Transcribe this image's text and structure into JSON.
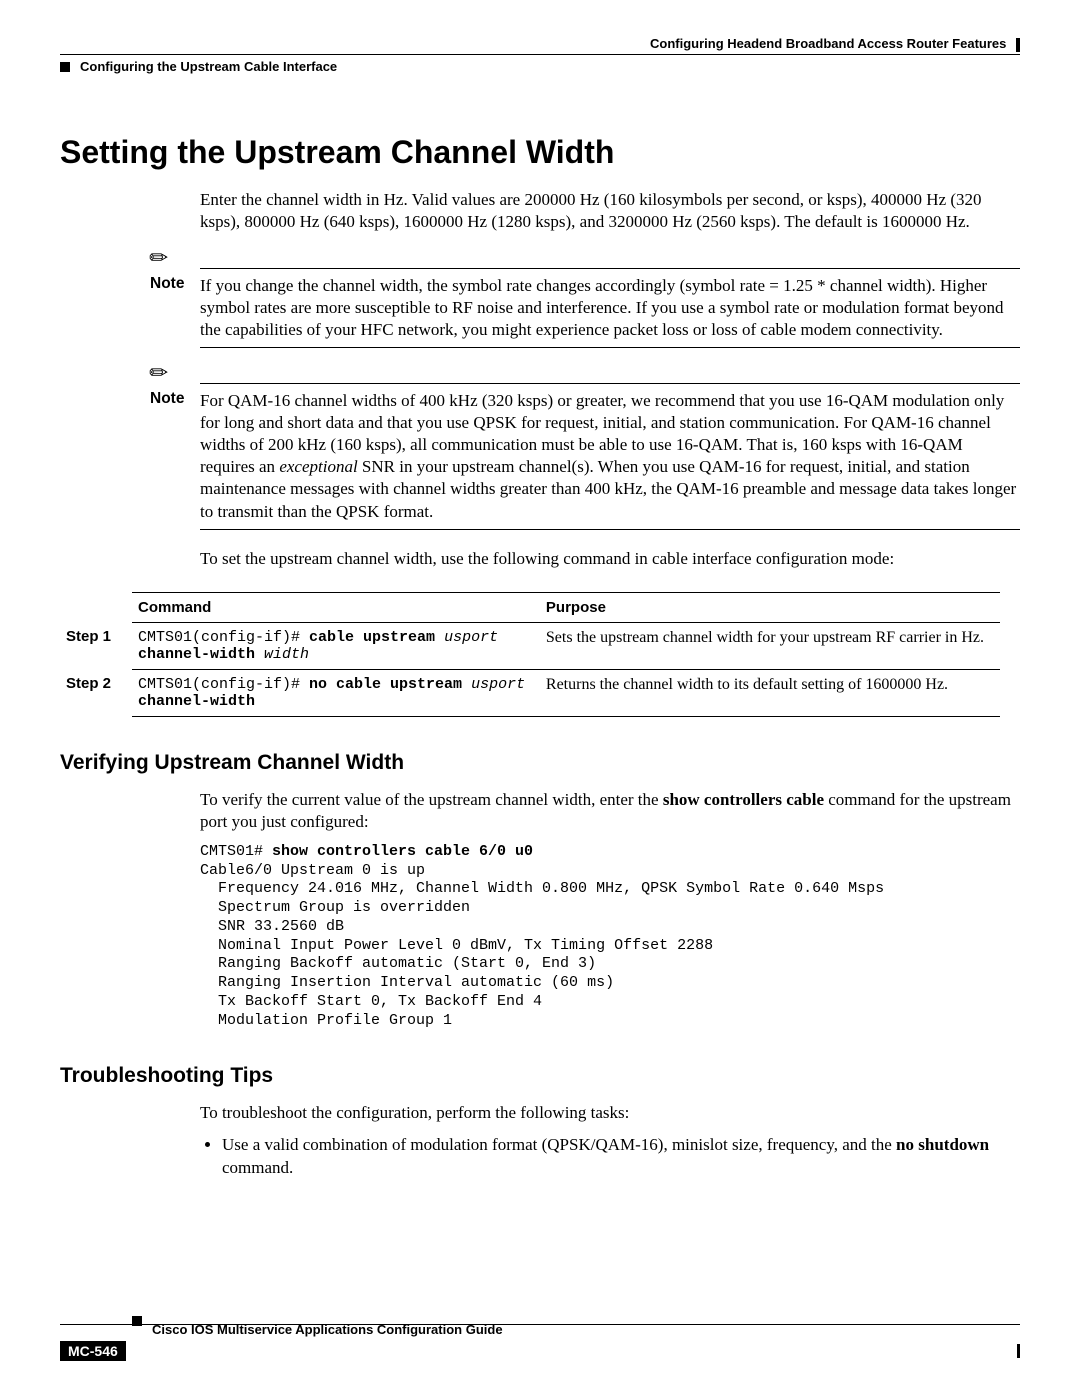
{
  "header": {
    "chapter": "Configuring Headend Broadband Access Router Features",
    "subsection": "Configuring the Upstream Cable Interface"
  },
  "section": {
    "title": "Setting the Upstream Channel Width",
    "intro": "Enter the channel width in Hz. Valid values are 200000 Hz (160 kilosymbols per second, or ksps), 400000 Hz (320 ksps), 800000 Hz (640 ksps), 1600000 Hz (1280 ksps), and 3200000 Hz (2560 ksps). The default is 1600000 Hz."
  },
  "notes": {
    "label": "Note",
    "n1": "If you change the channel width, the symbol rate changes accordingly (symbol rate = 1.25 * channel width). Higher symbol rates are more susceptible to RF noise and interference. If you use a symbol rate or modulation format beyond the capabilities of your HFC network, you might experience packet loss or loss of cable modem connectivity.",
    "n2_pre": "For QAM-16 channel widths of 400 kHz (320 ksps) or greater, we recommend that you use 16-QAM modulation only for long and short data and that you use QPSK for request, initial, and station communication. For QAM-16 channel widths of 200 kHz (160 ksps), all communication must be able to use 16-QAM. That is, 160 ksps with 16-QAM requires an ",
    "n2_em": "exceptional",
    "n2_post": " SNR in your upstream channel(s). When you use QAM-16 for request, initial, and station maintenance messages with channel widths greater than 400 kHz, the QAM-16 preamble and message data takes longer to transmit than the QPSK format."
  },
  "lead_in": "To set the upstream channel width, use the following command in cable interface configuration mode:",
  "table": {
    "h1": "Command",
    "h2": "Purpose",
    "rows": [
      {
        "step": "Step 1",
        "prompt": "CMTS01(config-if)# ",
        "cmd": "cable upstream",
        "arg1": " usport ",
        "cmd2": "channel-width",
        "arg2": " width",
        "purpose": "Sets the upstream channel width for your upstream RF carrier in Hz."
      },
      {
        "step": "Step 2",
        "prompt": "CMTS01(config-if)# ",
        "cmd": "no cable upstream",
        "arg1": " usport ",
        "cmd2": "channel-width",
        "arg2": "",
        "purpose": "Returns the channel width to its default setting of 1600000 Hz."
      }
    ]
  },
  "verify": {
    "title": "Verifying Upstream Channel Width",
    "intro_pre": "To verify the current value of the upstream channel width, enter the ",
    "intro_cmd": "show controllers cable",
    "intro_post": " command for the upstream port you just configured:",
    "cli_prompt": "CMTS01# ",
    "cli_cmd": "show controllers cable 6/0 u0",
    "output": "Cable6/0 Upstream 0 is up\n  Frequency 24.016 MHz, Channel Width 0.800 MHz, QPSK Symbol Rate 0.640 Msps\n  Spectrum Group is overridden\n  SNR 33.2560 dB\n  Nominal Input Power Level 0 dBmV, Tx Timing Offset 2288\n  Ranging Backoff automatic (Start 0, End 3)\n  Ranging Insertion Interval automatic (60 ms)\n  Tx Backoff Start 0, Tx Backoff End 4\n  Modulation Profile Group 1"
  },
  "trouble": {
    "title": "Troubleshooting Tips",
    "intro": "To troubleshoot the configuration, perform the following tasks:",
    "bullet_pre": "Use a valid combination of modulation format (QPSK/QAM-16), minislot size, frequency, and the ",
    "bullet_bold": "no shutdown",
    "bullet_post": " command."
  },
  "footer": {
    "doc": "Cisco IOS Multiservice Applications Configuration Guide",
    "page": "MC-546"
  }
}
